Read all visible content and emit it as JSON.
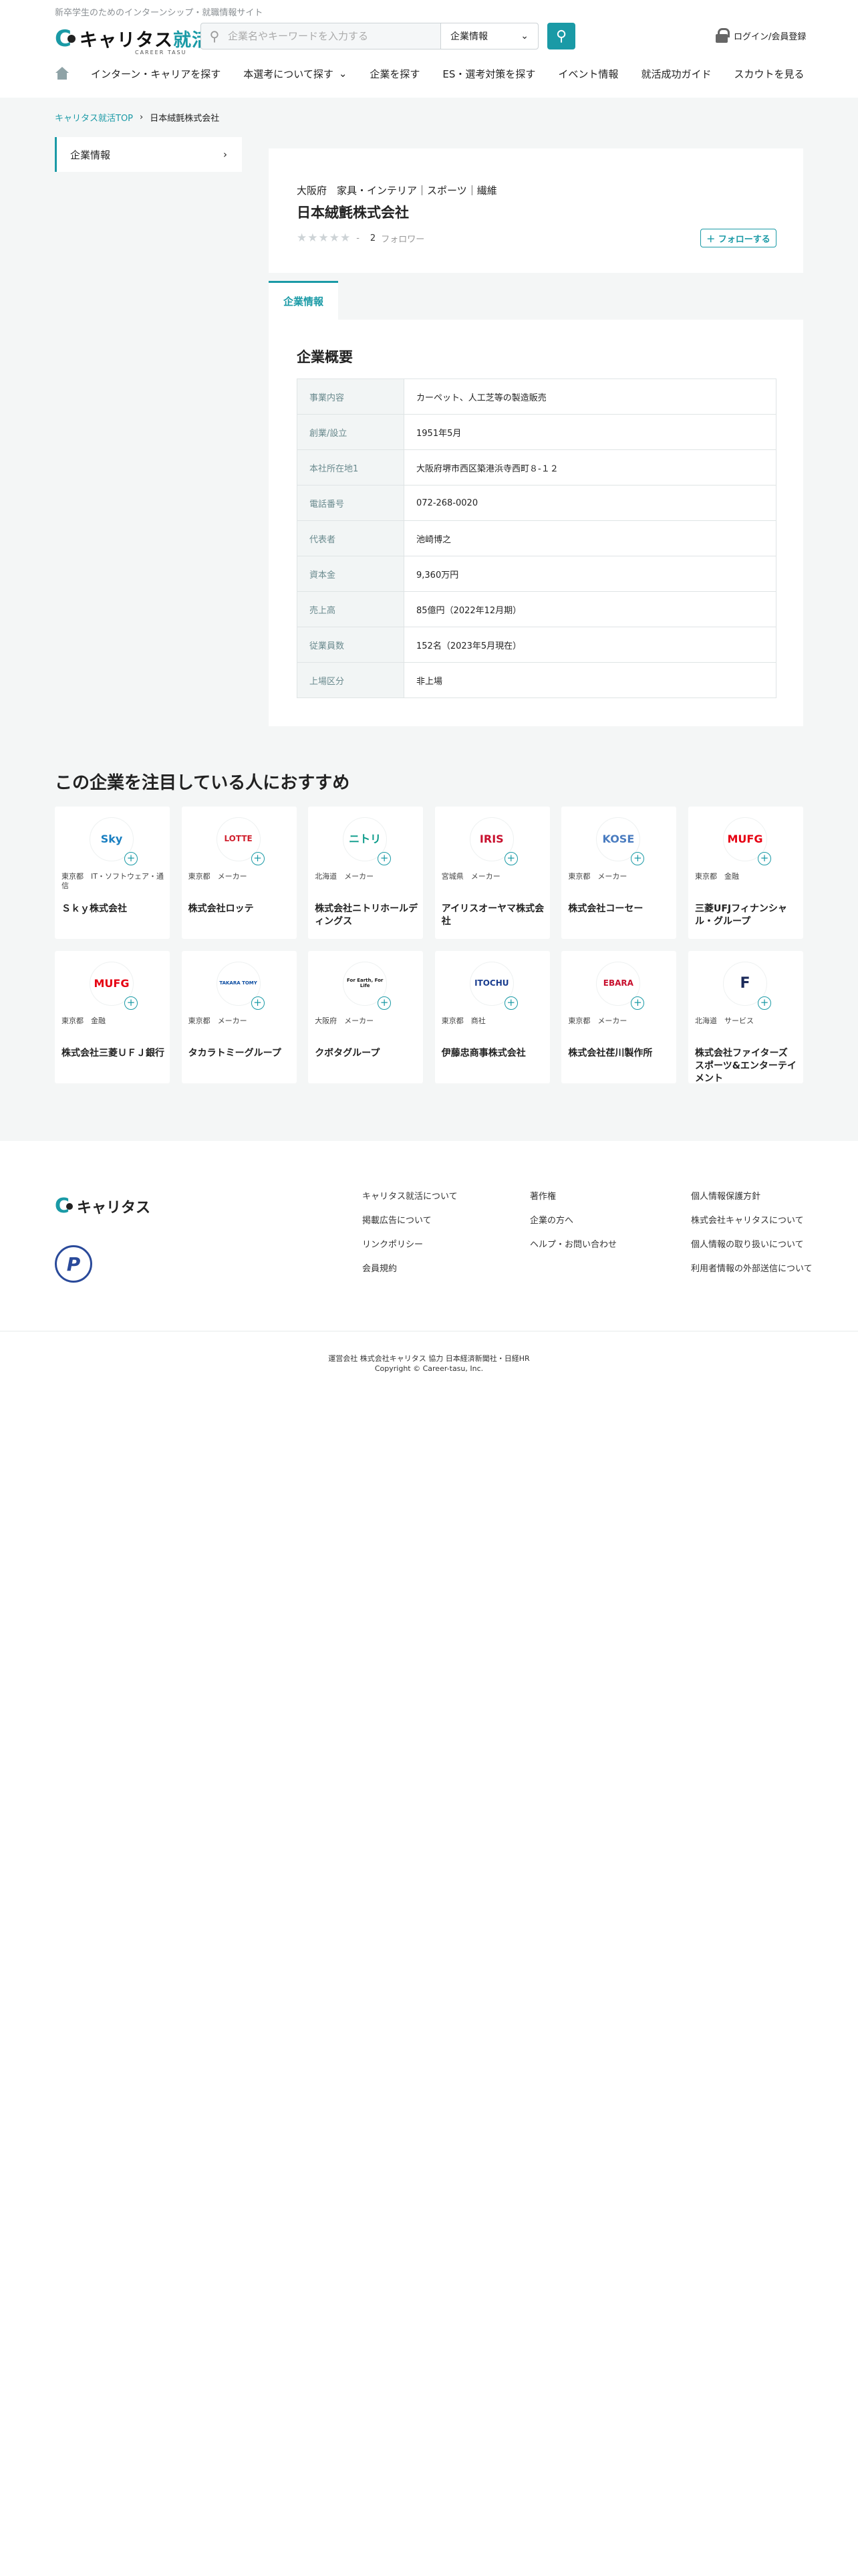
{
  "header": {
    "tagline": "新卒学生のためのインターンシップ・就職情報サイト",
    "logo_main": "キャリタス",
    "logo_accent": "就活",
    "logo_sub": "CAREER TASU",
    "search_placeholder": "企業名やキーワードを入力する",
    "search_select": "企業情報",
    "login": "ログイン/会員登録"
  },
  "nav": [
    {
      "label": "インターン・キャリアを探す",
      "caret": false
    },
    {
      "label": "本選考について探す",
      "caret": true
    },
    {
      "label": "企業を探す",
      "caret": false
    },
    {
      "label": "ES・選考対策を探す",
      "caret": false
    },
    {
      "label": "イベント情報",
      "caret": false
    },
    {
      "label": "就活成功ガイド",
      "caret": false
    },
    {
      "label": "スカウトを見る",
      "caret": false
    }
  ],
  "breadcrumb": {
    "top": "キャリタス就活TOP",
    "current": "日本絨氈株式会社"
  },
  "sidebar": {
    "item": "企業情報"
  },
  "company": {
    "categories": "大阪府　家具・インテリア｜スポーツ｜繊維",
    "name": "日本絨氈株式会社",
    "stars": "★★★★★",
    "dash": "-",
    "follower_count": "2",
    "follower_label": "フォロワー",
    "follow_button": "＋ フォローする"
  },
  "tab": {
    "label": "企業情報"
  },
  "overview": {
    "title": "企業概要",
    "rows": [
      {
        "key": "事業内容",
        "value": "カーペット、人工芝等の製造販売"
      },
      {
        "key": "創業/設立",
        "value": "1951年5月"
      },
      {
        "key": "本社所在地1",
        "value": "大阪府堺市西区築港浜寺西町８-１２"
      },
      {
        "key": "電話番号",
        "value": "072-268-0020"
      },
      {
        "key": "代表者",
        "value": "池崎博之"
      },
      {
        "key": "資本金",
        "value": "9,360万円"
      },
      {
        "key": "売上高",
        "value": "85億円（2022年12月期）"
      },
      {
        "key": "従業員数",
        "value": "152名（2023年5月現在）"
      },
      {
        "key": "上場区分",
        "value": "非上場"
      }
    ]
  },
  "recommend": {
    "title": "この企業を注目している人におすすめ",
    "items": [
      {
        "meta": "東京都　IT・ソフトウェア・通信",
        "name": "Ｓｋｙ株式会社",
        "logo": "Sky",
        "color": "#1a7fc1"
      },
      {
        "meta": "東京都　メーカー",
        "name": "株式会社ロッテ",
        "logo": "LOTTE",
        "color": "#d0202e"
      },
      {
        "meta": "北海道　メーカー",
        "name": "株式会社ニトリホールディングス",
        "logo": "ニトリ",
        "color": "#0b9b8a"
      },
      {
        "meta": "宮城県　メーカー",
        "name": "アイリスオーヤマ株式会社",
        "logo": "IRIS",
        "color": "#c8102e"
      },
      {
        "meta": "東京都　メーカー",
        "name": "株式会社コーセー",
        "logo": "KOSE",
        "color": "#4a7cc0"
      },
      {
        "meta": "東京都　金融",
        "name": "三菱UFJフィナンシャル・グループ",
        "logo": "MUFG",
        "color": "#e60012"
      },
      {
        "meta": "東京都　金融",
        "name": "株式会社三菱ＵＦＪ銀行",
        "logo": "MUFG",
        "color": "#e60012"
      },
      {
        "meta": "東京都　メーカー",
        "name": "タカラトミーグループ",
        "logo": "TAKARA TOMY",
        "color": "#0c4da2"
      },
      {
        "meta": "大阪府　メーカー",
        "name": "クボタグループ",
        "logo": "For Earth, For Life",
        "color": "#1a1a1a"
      },
      {
        "meta": "東京都　商社",
        "name": "伊藤忠商事株式会社",
        "logo": "ITOCHU",
        "color": "#1a3d8f"
      },
      {
        "meta": "東京都　メーカー",
        "name": "株式会社荏川製作所",
        "logo": "EBARA",
        "color": "#c8102e"
      },
      {
        "meta": "北海道　サービス",
        "name": "株式会社ファイターズ スポーツ&エンターテイメント",
        "logo": "F",
        "color": "#1b2a5a"
      }
    ]
  },
  "footer": {
    "logo": "キャリタス",
    "col1": [
      "キャリタス就活について",
      "掲載広告について",
      "リンクポリシー",
      "会員規約"
    ],
    "col2": [
      "著作権",
      "企業の方へ",
      "ヘルプ・お問い合わせ"
    ],
    "col3": [
      "個人情報保護方針",
      "株式会社キャリタスについて",
      "個人情報の取り扱いについて",
      "利用者情報の外部送信について"
    ],
    "operator": "運営会社 株式会社キャリタス 協力 日本経済新聞社・日経HR",
    "copyright": "Copyright © Career-tasu, Inc."
  },
  "colors": {
    "accent": "#1a9aa6",
    "bg": "#f4f6f6"
  }
}
